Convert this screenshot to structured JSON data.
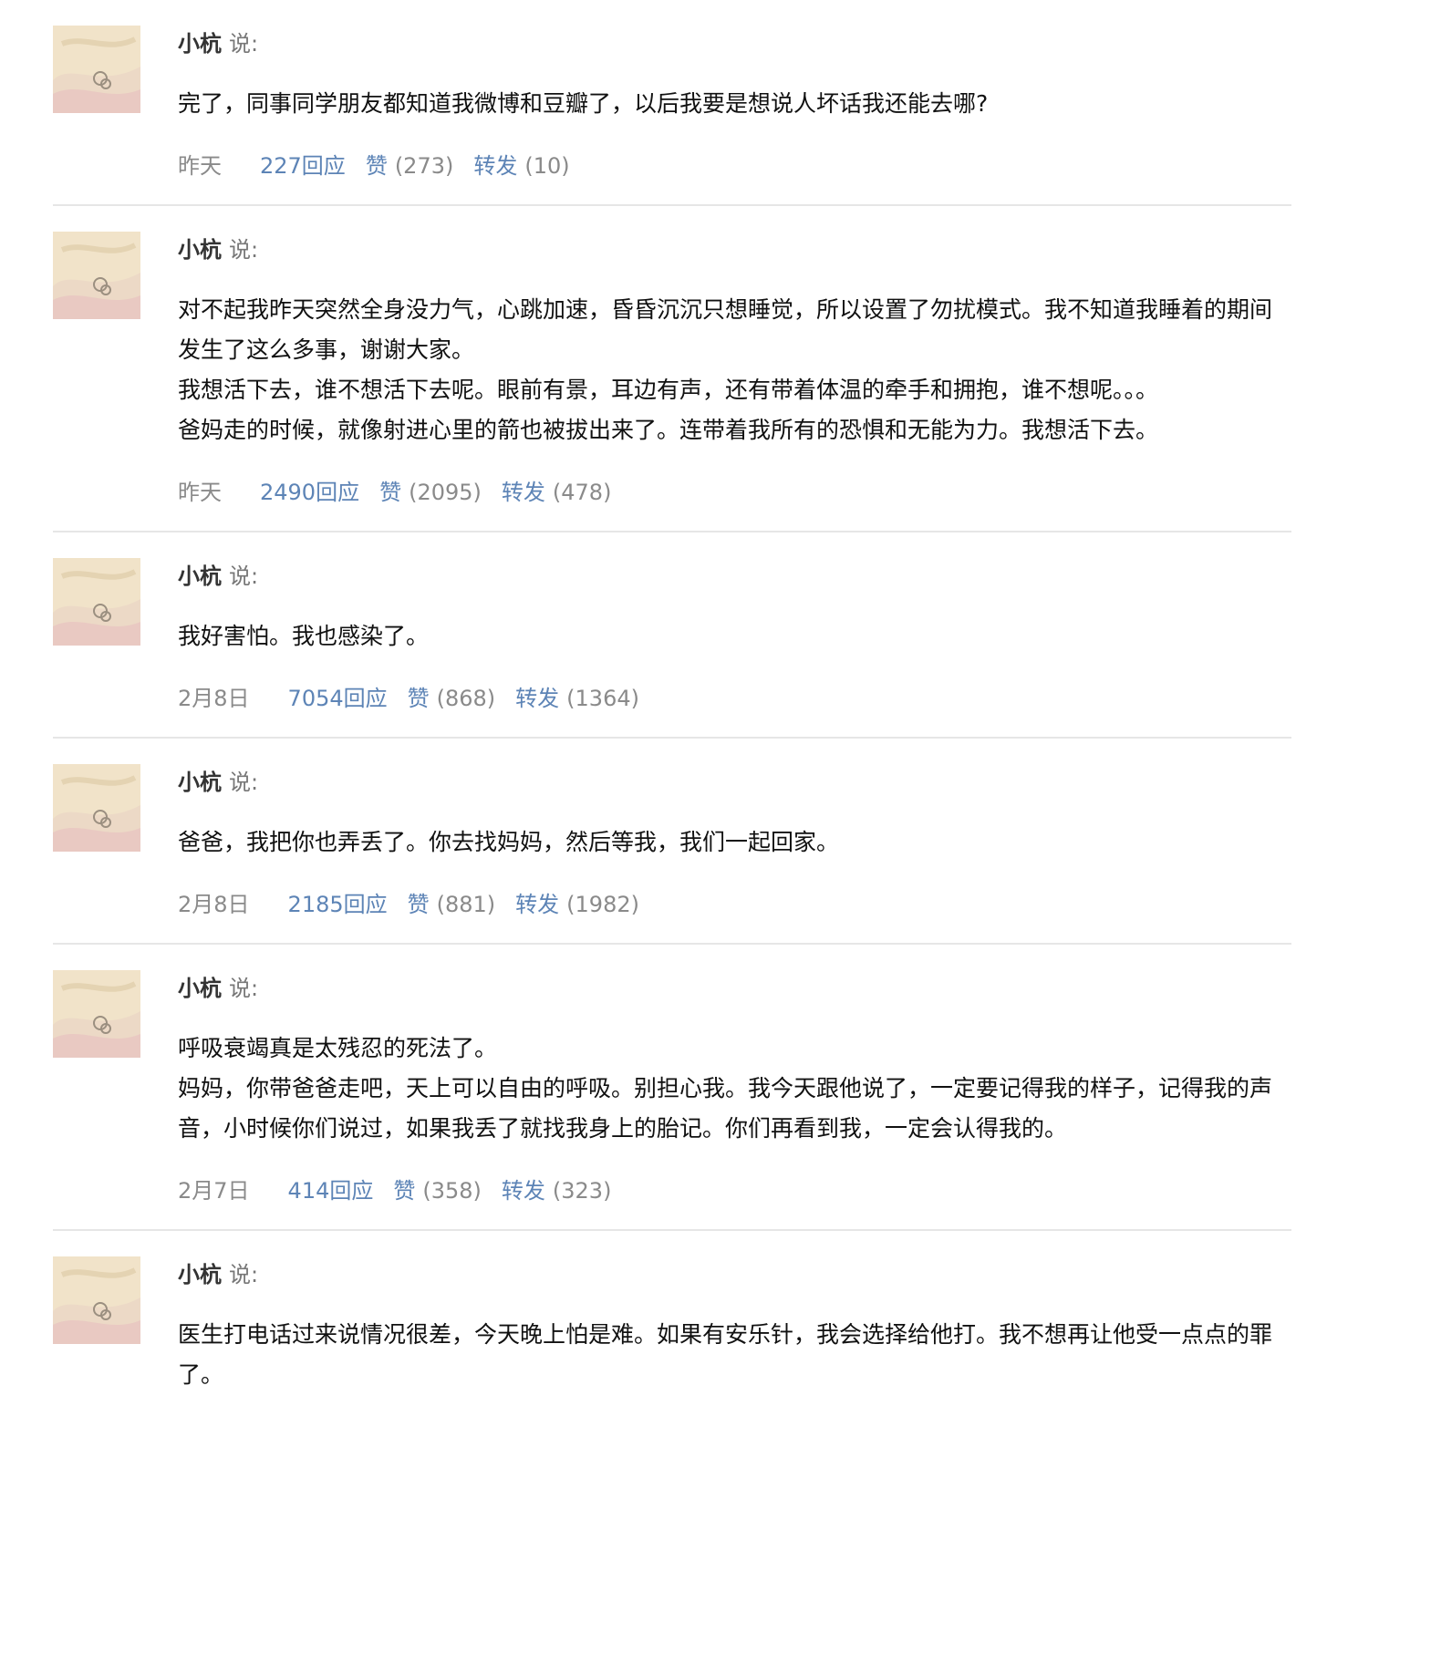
{
  "feed": {
    "statuses": [
      {
        "author": "小杭",
        "said": "说:",
        "lines": [
          "完了，同事同学朋友都知道我微博和豆瓣了，以后我要是想说人坏话我还能去哪?"
        ],
        "date": "昨天",
        "reply": "227回应",
        "like_label": "赞",
        "like_count": "(273)",
        "share_label": "转发",
        "share_count": "(10)"
      },
      {
        "author": "小杭",
        "said": "说:",
        "lines": [
          "对不起我昨天突然全身没力气，心跳加速，昏昏沉沉只想睡觉，所以设置了勿扰模式。我不知道我睡着的期间发生了这么多事，谢谢大家。",
          "我想活下去，谁不想活下去呢。眼前有景，耳边有声，还有带着体温的牵手和拥抱，谁不想呢。。。",
          "爸妈走的时候，就像射进心里的箭也被拔出来了。连带着我所有的恐惧和无能为力。我想活下去。"
        ],
        "date": "昨天",
        "reply": "2490回应",
        "like_label": "赞",
        "like_count": "(2095)",
        "share_label": "转发",
        "share_count": "(478)"
      },
      {
        "author": "小杭",
        "said": "说:",
        "lines": [
          "我好害怕。我也感染了。"
        ],
        "date": "2月8日",
        "reply": "7054回应",
        "like_label": "赞",
        "like_count": "(868)",
        "share_label": "转发",
        "share_count": "(1364)"
      },
      {
        "author": "小杭",
        "said": "说:",
        "lines": [
          "爸爸，我把你也弄丢了。你去找妈妈，然后等我，我们一起回家。"
        ],
        "date": "2月8日",
        "reply": "2185回应",
        "like_label": "赞",
        "like_count": "(881)",
        "share_label": "转发",
        "share_count": "(1982)"
      },
      {
        "author": "小杭",
        "said": "说:",
        "lines": [
          "呼吸衰竭真是太残忍的死法了。",
          "妈妈，你带爸爸走吧，天上可以自由的呼吸。别担心我。我今天跟他说了，一定要记得我的样子，记得我的声音，小时候你们说过，如果我丢了就找我身上的胎记。你们再看到我，一定会认得我的。"
        ],
        "date": "2月7日",
        "reply": "414回应",
        "like_label": "赞",
        "like_count": "(358)",
        "share_label": "转发",
        "share_count": "(323)"
      },
      {
        "author": "小杭",
        "said": "说:",
        "lines": [
          "医生打电话过来说情况很差，今天晚上怕是难。如果有安乐针，我会选择给他打。我不想再让他受一点点的罪了。"
        ]
      }
    ]
  }
}
